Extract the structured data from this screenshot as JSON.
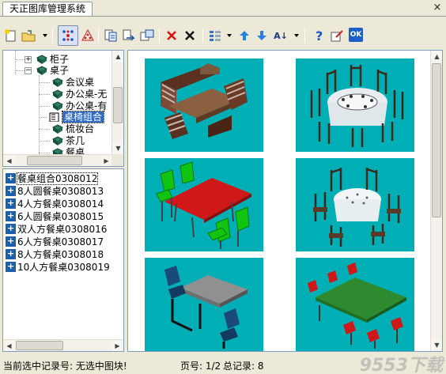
{
  "window": {
    "tab_title": "天正图库管理系统",
    "close_label": "×"
  },
  "toolbar": {
    "items": [
      {
        "name": "new-icon"
      },
      {
        "name": "open-folder-icon"
      },
      {
        "name": "dropdown-icon"
      },
      {
        "name": "dots-grid-icon"
      },
      {
        "name": "triangle-dots-icon"
      },
      {
        "name": "import-icon"
      },
      {
        "name": "export-icon"
      },
      {
        "name": "rename-icon"
      },
      {
        "name": "delete-red-icon"
      },
      {
        "name": "delete-black-icon"
      },
      {
        "name": "view-icon"
      },
      {
        "name": "move-up-icon"
      },
      {
        "name": "move-down-icon"
      },
      {
        "name": "sort-icon"
      },
      {
        "name": "help-icon"
      },
      {
        "name": "edit-icon"
      },
      {
        "name": "ok-icon"
      }
    ],
    "ok_label": "OK",
    "sort_label": "A↓"
  },
  "tree": {
    "items": [
      {
        "label": "柜子",
        "level": 1,
        "expander": "+"
      },
      {
        "label": "桌子",
        "level": 1,
        "expander": "−"
      },
      {
        "label": "会议桌",
        "level": 2
      },
      {
        "label": "办公桌-无",
        "level": 2
      },
      {
        "label": "办公桌-有",
        "level": 2
      },
      {
        "label": "桌椅组合",
        "level": 2,
        "selected": true
      },
      {
        "label": "梳妆台",
        "level": 2
      },
      {
        "label": "茶几",
        "level": 2
      },
      {
        "label": "餐桌",
        "level": 2
      }
    ]
  },
  "records": [
    {
      "label": "餐桌组合0308012",
      "selected": true
    },
    {
      "label": "8人圆餐桌0308013"
    },
    {
      "label": "4人方餐桌0308014"
    },
    {
      "label": "6人圆餐桌0308015"
    },
    {
      "label": "双人方餐桌0308016"
    },
    {
      "label": "6人方餐桌0308017"
    },
    {
      "label": "8人方餐桌0308018"
    },
    {
      "label": "10人方餐桌0308019"
    }
  ],
  "thumbnails": [
    {
      "name": "booth-table-set"
    },
    {
      "name": "round-table-8"
    },
    {
      "name": "red-table-green-chairs"
    },
    {
      "name": "round-table-6"
    },
    {
      "name": "grey-table-fixed-seats"
    },
    {
      "name": "green-table-red-seats"
    }
  ],
  "colors": {
    "thumb_bg": "#00aeb6",
    "selection": "#316ac5"
  },
  "status": {
    "current_record": "当前选中记录号: 无选中图块!",
    "page": "页号: 1/2",
    "total": "总记录: 8"
  },
  "watermark": "9553下载"
}
